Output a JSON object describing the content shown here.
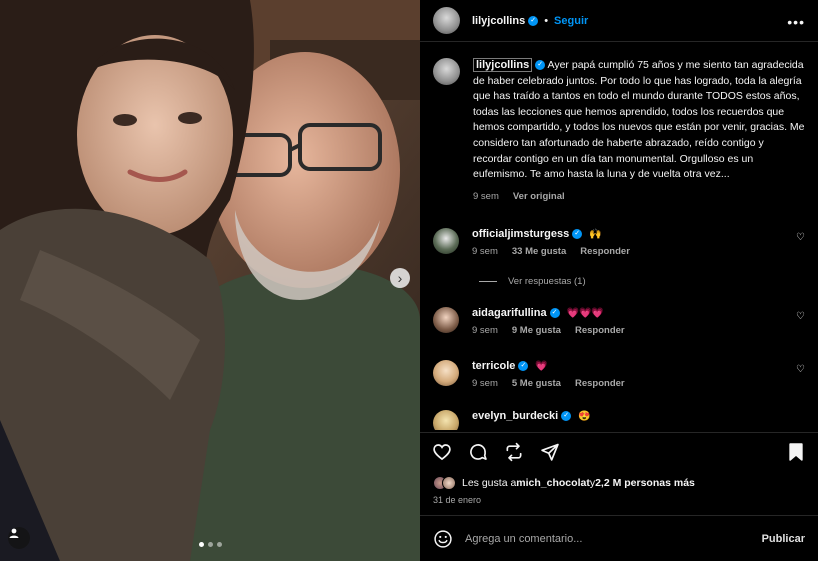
{
  "post": {
    "author": "lilyjcollins",
    "follow_label": "Seguir",
    "separator": "•",
    "more_icon": "more-horizontal-icon",
    "caption": "Ayer papá cumplió 75 años y me siento tan agradecida de haber celebrado juntos. Por todo lo que has logrado, toda la alegría que has traído a tantos en todo el mundo durante TODOS estos años, todas las lecciones que hemos aprendido, todos los recuerdos que hemos compartido, y todos los nuevos que están por venir, gracias. Me considero tan afortunado de haberte abrazado, reído contigo y recordar contigo en un día tan monumental. Orgulloso es un eufemismo. Te amo hasta la luna y de vuelta otra vez...",
    "caption_time": "9 sem",
    "view_original": "Ver original"
  },
  "comments": [
    {
      "user": "officialjimsturgess",
      "text": "🙌",
      "time": "9 sem",
      "likes": "33 Me gusta",
      "reply": "Responder"
    },
    {
      "user": "aidagarifullina",
      "text": "💗💗💗",
      "time": "9 sem",
      "likes": "9 Me gusta",
      "reply": "Responder"
    },
    {
      "user": "terricole",
      "text": "💗",
      "time": "9 sem",
      "likes": "5 Me gusta",
      "reply": "Responder"
    },
    {
      "user": "evelyn_burdecki",
      "text": "😍"
    }
  ],
  "view_replies": "Ver respuestas (1)",
  "likes": {
    "prefix": "Les gusta a ",
    "user": "mich_chocolat",
    "middle": " y ",
    "count": "2,2 M personas más"
  },
  "date": "31 de enero",
  "composer": {
    "placeholder": "Agrega un comentario...",
    "post_label": "Publicar"
  },
  "carousel": {
    "slides": 3,
    "current": 1
  },
  "colors": {
    "accent": "#0095f6",
    "background": "#000000",
    "muted": "#a8a8a8"
  }
}
